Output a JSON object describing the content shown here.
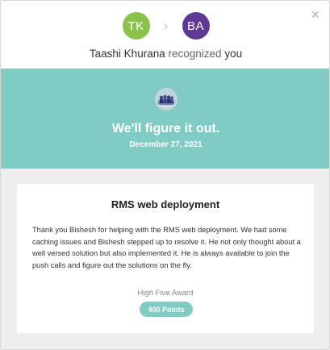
{
  "header": {
    "sender_initials": "TK",
    "receiver_initials": "BA",
    "separator": "›",
    "close_glyph": "×",
    "sender_name": "Taashi Khurana",
    "recognized_text": "recognized",
    "receiver_word": "you"
  },
  "banner": {
    "title": "We'll figure it out.",
    "date": "December 27, 2021",
    "badge_icon": "team-badge-icon"
  },
  "detail": {
    "title": "RMS web deployment",
    "message": "Thank you Bishesh for helping with the RMS web deployment. We had some caching issues and Bishesh stepped up to resolve it. He not only thought about a well versed solution but also implemented it. He is always available to join the push calls and figure out the solutions on the fly.",
    "award_name": "High Five Award",
    "points": "400 Points"
  },
  "colors": {
    "teal": "#80cbc4",
    "tk_avatar": "#8bc34a",
    "ba_avatar": "#5e3a92"
  }
}
